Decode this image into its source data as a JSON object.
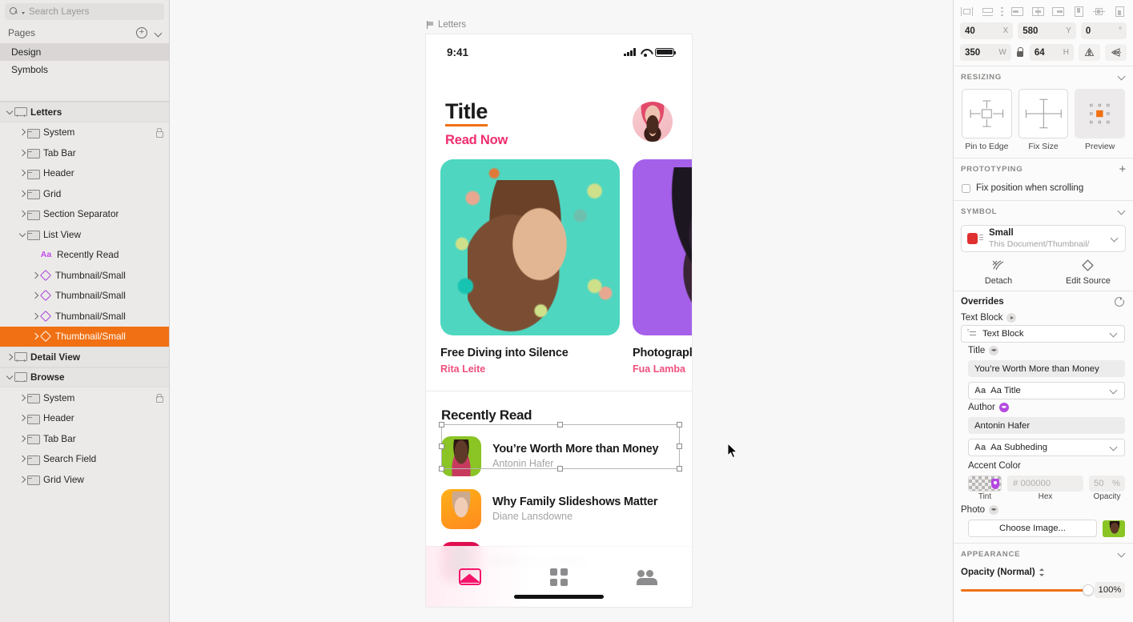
{
  "sidebar": {
    "search": {
      "placeholder": "Search Layers",
      "icon": "search-icon"
    },
    "pages": {
      "title": "Pages",
      "add_icon": "plus-circle-icon",
      "collapse_icon": "chevron-down-icon",
      "items": [
        {
          "label": "Design",
          "selected": true
        },
        {
          "label": "Symbols",
          "selected": false
        }
      ]
    },
    "layers": [
      {
        "label": "Letters",
        "type": "artboard",
        "depth": 0,
        "expanded": true,
        "selected": false,
        "locked": false
      },
      {
        "label": "System",
        "type": "folder",
        "depth": 1,
        "expanded": false,
        "selected": false,
        "locked": true
      },
      {
        "label": "Tab Bar",
        "type": "folder",
        "depth": 1,
        "expanded": false,
        "selected": false,
        "locked": false
      },
      {
        "label": "Header",
        "type": "folder",
        "depth": 1,
        "expanded": false,
        "selected": false,
        "locked": false
      },
      {
        "label": "Grid",
        "type": "folder",
        "depth": 1,
        "expanded": false,
        "selected": false,
        "locked": false
      },
      {
        "label": "Section Separator",
        "type": "folder",
        "depth": 1,
        "expanded": false,
        "selected": false,
        "locked": false
      },
      {
        "label": "List View",
        "type": "folder",
        "depth": 1,
        "expanded": true,
        "selected": false,
        "locked": false
      },
      {
        "label": "Recently Read",
        "type": "text",
        "depth": 2,
        "expanded": null,
        "selected": false,
        "locked": false
      },
      {
        "label": "Thumbnail/Small",
        "type": "symbol",
        "depth": 2,
        "expanded": false,
        "selected": false,
        "locked": false
      },
      {
        "label": "Thumbnail/Small",
        "type": "symbol",
        "depth": 2,
        "expanded": false,
        "selected": false,
        "locked": false
      },
      {
        "label": "Thumbnail/Small",
        "type": "symbol",
        "depth": 2,
        "expanded": false,
        "selected": false,
        "locked": false
      },
      {
        "label": "Thumbnail/Small",
        "type": "symbol",
        "depth": 2,
        "expanded": false,
        "selected": true,
        "locked": false
      },
      {
        "label": "Detail View",
        "type": "artboard",
        "depth": 0,
        "expanded": false,
        "selected": false,
        "locked": false
      },
      {
        "label": "Browse",
        "type": "artboard",
        "depth": 0,
        "expanded": true,
        "selected": false,
        "locked": false
      },
      {
        "label": "System",
        "type": "folder",
        "depth": 1,
        "expanded": false,
        "selected": false,
        "locked": true
      },
      {
        "label": "Header",
        "type": "folder",
        "depth": 1,
        "expanded": false,
        "selected": false,
        "locked": false
      },
      {
        "label": "Tab Bar",
        "type": "folder",
        "depth": 1,
        "expanded": false,
        "selected": false,
        "locked": false
      },
      {
        "label": "Search Field",
        "type": "folder",
        "depth": 1,
        "expanded": false,
        "selected": false,
        "locked": false
      },
      {
        "label": "Grid View",
        "type": "folder",
        "depth": 1,
        "expanded": false,
        "selected": false,
        "locked": false
      }
    ]
  },
  "canvas": {
    "artboard_label": "Letters",
    "phone": {
      "status_bar": {
        "time": "9:41",
        "signal_icon": "cellular-signal-icon",
        "wifi_icon": "wifi-icon",
        "battery_icon": "battery-icon"
      },
      "hero": {
        "title": "Title",
        "subtitle": "Read Now",
        "avatar": "user-avatar"
      },
      "cards": [
        {
          "title": "Free Diving into Silence",
          "author": "Rita Leite",
          "color": "#4ed6c0"
        },
        {
          "title": "Photographi",
          "author": "Fua Lamba",
          "color": "#a560ea"
        }
      ],
      "list_header": "Recently Read",
      "list_items": [
        {
          "title": "You’re Worth More than Money",
          "author": "Antonin Hafer",
          "thumb": "green",
          "selected": true
        },
        {
          "title": "Why Family Slideshows Matter",
          "author": "Diane Lansdowne",
          "thumb": "orange",
          "selected": false
        },
        {
          "title": "Birds of a Feather",
          "author": "",
          "thumb": "red",
          "selected": false
        }
      ],
      "tabbar": [
        {
          "icon": "envelope-icon",
          "active": true
        },
        {
          "icon": "grid-icon",
          "active": false
        },
        {
          "icon": "people-icon",
          "active": false
        }
      ]
    }
  },
  "inspector": {
    "align_icons": [
      "align-left-icon",
      "align-middle-icon",
      "distribute-icon",
      "align-horizontal-left-icon",
      "align-horizontal-center-icon",
      "align-horizontal-right-icon",
      "align-vertical-top-icon",
      "align-vertical-middle-icon",
      "align-vertical-bottom-icon"
    ],
    "geometry": {
      "x": {
        "value": "40",
        "unit": "X"
      },
      "y": {
        "value": "580",
        "unit": "Y"
      },
      "rotation": {
        "value": "0",
        "unit": "°"
      },
      "w": {
        "value": "350",
        "unit": "W"
      },
      "h": {
        "value": "64",
        "unit": "H"
      },
      "lock_icon": "lock-proportions-icon",
      "flip_horizontal_icon": "flip-horizontal-icon",
      "flip_vertical_icon": "flip-vertical-icon"
    },
    "resizing": {
      "title": "RESIZING",
      "options": [
        {
          "label": "Pin to Edge",
          "active": false
        },
        {
          "label": "Fix Size",
          "active": false
        },
        {
          "label": "Preview",
          "active": true
        }
      ]
    },
    "prototyping": {
      "title": "PROTOTYPING",
      "add_icon": "plus-icon",
      "fix_position_label": "Fix position when scrolling",
      "fix_position_checked": false
    },
    "symbol": {
      "title": "SYMBOL",
      "name": "Small",
      "path": "This Document/Thumbnail/",
      "detach_label": "Detach",
      "edit_source_label": "Edit Source",
      "detach_icon": "detach-icon",
      "edit_source_icon": "symbol-diamond-icon"
    },
    "overrides": {
      "title": "Overrides",
      "reset_icon": "reset-icon",
      "text_block_label": "Text Block",
      "text_block_value": "Text Block",
      "title_label": "Title",
      "title_value": "You’re Worth More than Money",
      "title_style": "Aa Title",
      "author_label": "Author",
      "author_value": "Antonin Hafer",
      "author_style": "Aa Subheding",
      "accent_color_label": "Accent Color",
      "accent_hex_placeholder": "# 000000",
      "accent_opacity": "50",
      "accent_opacity_unit": "%",
      "cap_tint": "Tint",
      "cap_hex": "Hex",
      "cap_opacity": "Opacity",
      "photo_label": "Photo",
      "choose_image_label": "Choose Image..."
    },
    "appearance": {
      "title": "APPEARANCE",
      "opacity_label": "Opacity (Normal)",
      "opacity_value": "100%",
      "opacity_pct": 100,
      "accent_color": "#f07013"
    }
  }
}
